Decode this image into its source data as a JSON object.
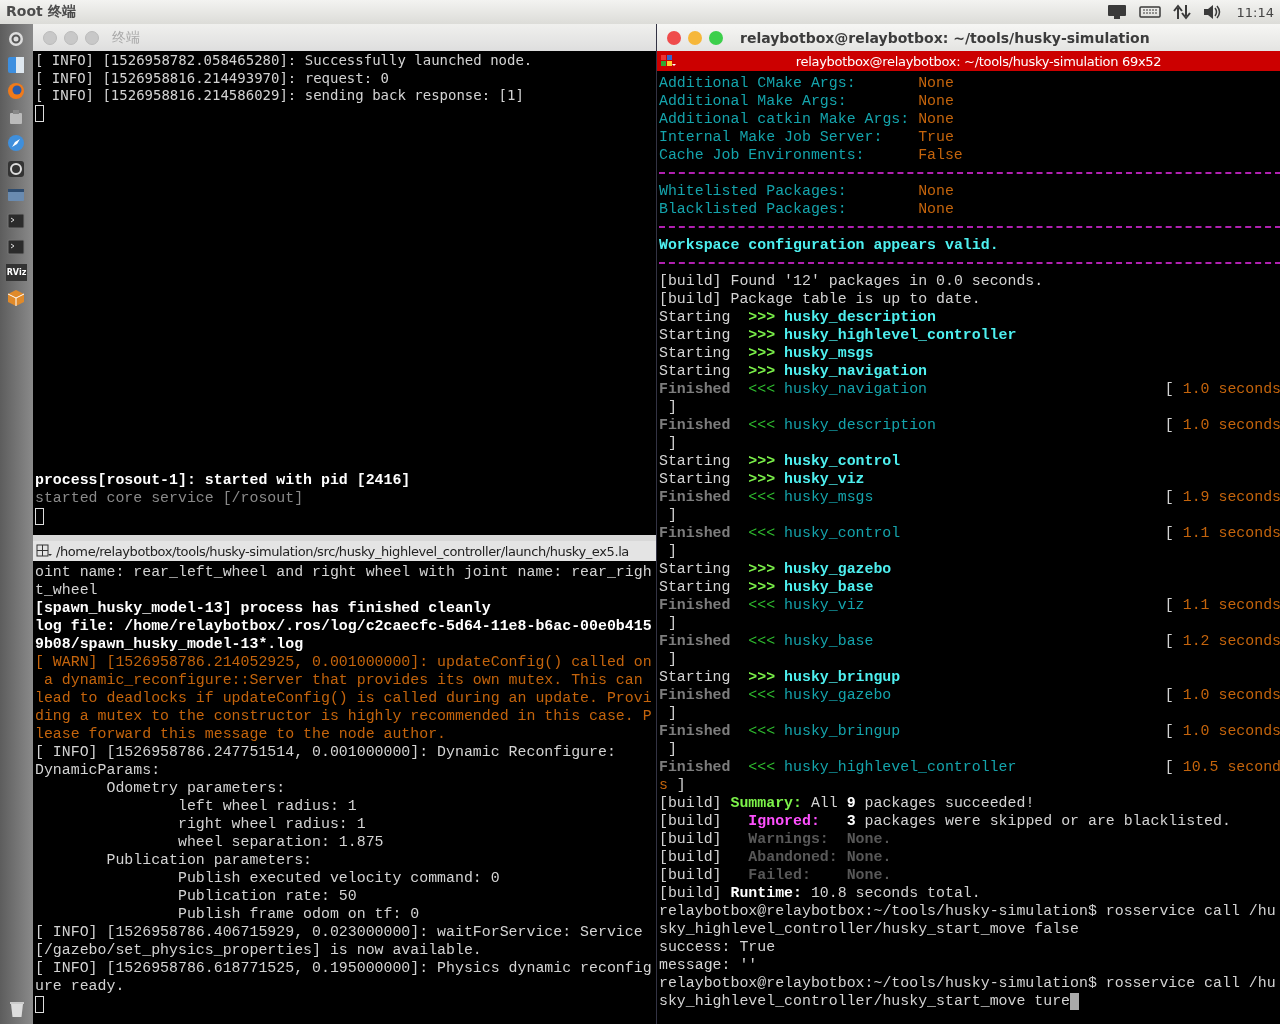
{
  "top_bar": {
    "title": "Root 终端",
    "indicators": [
      {
        "kind": "display"
      },
      {
        "kind": "keyboard"
      },
      {
        "kind": "network"
      },
      {
        "kind": "speaker"
      }
    ],
    "clock": "11:14"
  },
  "launcher": {
    "items": [
      {
        "kind": "ring"
      },
      {
        "kind": "face"
      },
      {
        "kind": "globe"
      },
      {
        "kind": "drive"
      },
      {
        "kind": "compass"
      },
      {
        "kind": "disc"
      },
      {
        "kind": "window"
      },
      {
        "kind": "terminal"
      },
      {
        "kind": "terminal"
      },
      {
        "kind": "label",
        "label": "RViz"
      },
      {
        "kind": "package"
      }
    ],
    "trash": {
      "kind": "trash"
    }
  },
  "left_window": {
    "title": "终端",
    "active": false,
    "lines": [
      {
        "kind": "text",
        "segments": [
          {
            "text": "[ INFO] [1526958782.058465280]: Successfully launched node.",
            "kind": "plain"
          }
        ]
      },
      {
        "kind": "text",
        "segments": [
          {
            "text": "[ INFO] [1526958816.214493970]: request: 0",
            "kind": "plain"
          }
        ]
      },
      {
        "kind": "text",
        "segments": [
          {
            "text": "[ INFO] [1526958816.214586029]: sending back response: [1]",
            "kind": "plain"
          }
        ]
      },
      {
        "kind": "cursor",
        "focused": false
      }
    ]
  },
  "middle_pane": {
    "lines": [
      {
        "kind": "text",
        "segments": [
          {
            "text": "process[rosout-1]: started with pid [2416]",
            "kind": "bold"
          }
        ]
      },
      {
        "kind": "text",
        "segments": [
          {
            "text": "started core service [/rosout]",
            "kind": "dim"
          }
        ]
      },
      {
        "kind": "cursor",
        "focused": false
      }
    ]
  },
  "bottom_pane": {
    "title": "/home/relaybotbox/tools/husky-simulation/src/husky_highlevel_controller/launch/husky_ex5.la",
    "lines": [
      {
        "kind": "text",
        "segments": [
          {
            "text": "oint name: rear_left_wheel and right wheel with joint name: rear_righ",
            "kind": "plain"
          }
        ]
      },
      {
        "kind": "text",
        "segments": [
          {
            "text": "t_wheel",
            "kind": "plain"
          }
        ]
      },
      {
        "kind": "text",
        "segments": [
          {
            "text": "[spawn_husky_model-13] process has finished cleanly",
            "kind": "bold"
          }
        ]
      },
      {
        "kind": "text",
        "segments": [
          {
            "text": "log file: /home/relaybotbox/.ros/log/c2caecfc-5d64-11e8-b6ac-00e0b415",
            "kind": "bold"
          }
        ]
      },
      {
        "kind": "text",
        "segments": [
          {
            "text": "9b08/spawn_husky_model-13*.log",
            "kind": "bold"
          }
        ]
      },
      {
        "kind": "text",
        "segments": [
          {
            "text": "[ WARN] [1526958786.214052925, 0.001000000]: updateConfig() called on",
            "kind": "warn"
          }
        ]
      },
      {
        "kind": "text",
        "segments": [
          {
            "text": " a dynamic_reconfigure::Server that provides its own mutex. This can",
            "kind": "warn"
          }
        ]
      },
      {
        "kind": "text",
        "segments": [
          {
            "text": "lead to deadlocks if updateConfig() is called during an update. Provi",
            "kind": "warn"
          }
        ]
      },
      {
        "kind": "text",
        "segments": [
          {
            "text": "ding a mutex to the constructor is highly recommended in this case. P",
            "kind": "warn"
          }
        ]
      },
      {
        "kind": "text",
        "segments": [
          {
            "text": "lease forward this message to the node author.",
            "kind": "warn"
          }
        ]
      },
      {
        "kind": "text",
        "segments": [
          {
            "text": "[ INFO] [1526958786.247751514, 0.001000000]: Dynamic Reconfigure:",
            "kind": "plain"
          }
        ]
      },
      {
        "kind": "text",
        "segments": [
          {
            "text": "DynamicParams:",
            "kind": "plain"
          }
        ]
      },
      {
        "kind": "text",
        "segments": [
          {
            "text": "        Odometry parameters:",
            "kind": "plain"
          }
        ]
      },
      {
        "kind": "text",
        "segments": [
          {
            "text": "                left wheel radius: 1",
            "kind": "plain"
          }
        ]
      },
      {
        "kind": "text",
        "segments": [
          {
            "text": "                right wheel radius: 1",
            "kind": "plain"
          }
        ]
      },
      {
        "kind": "text",
        "segments": [
          {
            "text": "                wheel separation: 1.875",
            "kind": "plain"
          }
        ]
      },
      {
        "kind": "text",
        "segments": [
          {
            "text": "        Publication parameters:",
            "kind": "plain"
          }
        ]
      },
      {
        "kind": "text",
        "segments": [
          {
            "text": "                Publish executed velocity command: 0",
            "kind": "plain"
          }
        ]
      },
      {
        "kind": "text",
        "segments": [
          {
            "text": "                Publication rate: 50",
            "kind": "plain"
          }
        ]
      },
      {
        "kind": "text",
        "segments": [
          {
            "text": "                Publish frame odom on tf: 0",
            "kind": "plain"
          }
        ]
      },
      {
        "kind": "text",
        "segments": [
          {
            "text": "[ INFO] [1526958786.406715929, 0.023000000]: waitForService: Service",
            "kind": "plain"
          }
        ]
      },
      {
        "kind": "text",
        "segments": [
          {
            "text": "[/gazebo/set_physics_properties] is now available.",
            "kind": "plain"
          }
        ]
      },
      {
        "kind": "text",
        "segments": [
          {
            "text": "[ INFO] [1526958786.618771525, 0.195000000]: Physics dynamic reconfig",
            "kind": "plain"
          }
        ]
      },
      {
        "kind": "text",
        "segments": [
          {
            "text": "ure ready.",
            "kind": "plain"
          }
        ]
      },
      {
        "kind": "cursor",
        "focused": false
      }
    ]
  },
  "right_window": {
    "title": "relaybotbox@relaybotbox: ~/tools/husky-simulation",
    "active": true,
    "pane_title": "relaybotbox@relaybotbox: ~/tools/husky-simulation 69x52",
    "lines": [
      {
        "kind": "setting",
        "key": "Additional CMake Args:",
        "value": "None"
      },
      {
        "kind": "setting",
        "key": "Additional Make Args:",
        "value": "None"
      },
      {
        "kind": "setting",
        "key": "Additional catkin Make Args:",
        "value": "None"
      },
      {
        "kind": "setting",
        "key": "Internal Make Job Server:",
        "value": "True"
      },
      {
        "kind": "setting",
        "key": "Cache Job Environments:",
        "value": "False"
      },
      {
        "kind": "divider"
      },
      {
        "kind": "setting",
        "key": "Whitelisted Packages:",
        "value": "None"
      },
      {
        "kind": "setting",
        "key": "Blacklisted Packages:",
        "value": "None"
      },
      {
        "kind": "divider"
      },
      {
        "kind": "text",
        "segments": [
          {
            "text": "Workspace configuration appears valid.",
            "kind": "cyan-bold"
          }
        ]
      },
      {
        "kind": "divider"
      },
      {
        "kind": "text",
        "segments": [
          {
            "text": "[build] Found '12' packages in 0.0 seconds.",
            "kind": "plain"
          }
        ]
      },
      {
        "kind": "text",
        "segments": [
          {
            "text": "[build] Package table is up to date.",
            "kind": "plain"
          }
        ]
      },
      {
        "kind": "start",
        "status": "Starting",
        "marker": ">>>",
        "package": "husky_description"
      },
      {
        "kind": "start",
        "status": "Starting",
        "marker": ">>>",
        "package": "husky_highlevel_controller"
      },
      {
        "kind": "start",
        "status": "Starting",
        "marker": ">>>",
        "package": "husky_msgs"
      },
      {
        "kind": "start",
        "status": "Starting",
        "marker": ">>>",
        "package": "husky_navigation"
      },
      {
        "kind": "finish",
        "status": "Finished",
        "marker": "<<<",
        "package": "husky_navigation",
        "open": "[",
        "time": "1.0 seconds"
      },
      {
        "kind": "close",
        "text": "]"
      },
      {
        "kind": "finish",
        "status": "Finished",
        "marker": "<<<",
        "package": "husky_description",
        "open": "[",
        "time": "1.0 seconds"
      },
      {
        "kind": "close",
        "text": "]"
      },
      {
        "kind": "start",
        "status": "Starting",
        "marker": ">>>",
        "package": "husky_control"
      },
      {
        "kind": "start",
        "status": "Starting",
        "marker": ">>>",
        "package": "husky_viz"
      },
      {
        "kind": "finish",
        "status": "Finished",
        "marker": "<<<",
        "package": "husky_msgs",
        "open": "[",
        "time": "1.9 seconds"
      },
      {
        "kind": "close",
        "text": "]"
      },
      {
        "kind": "finish",
        "status": "Finished",
        "marker": "<<<",
        "package": "husky_control",
        "open": "[",
        "time": "1.1 seconds"
      },
      {
        "kind": "close",
        "text": "]"
      },
      {
        "kind": "start",
        "status": "Starting",
        "marker": ">>>",
        "package": "husky_gazebo"
      },
      {
        "kind": "start",
        "status": "Starting",
        "marker": ">>>",
        "package": "husky_base"
      },
      {
        "kind": "finish",
        "status": "Finished",
        "marker": "<<<",
        "package": "husky_viz",
        "open": "[",
        "time": "1.1 seconds"
      },
      {
        "kind": "close",
        "text": "]"
      },
      {
        "kind": "finish",
        "status": "Finished",
        "marker": "<<<",
        "package": "husky_base",
        "open": "[",
        "time": "1.2 seconds"
      },
      {
        "kind": "close",
        "text": "]"
      },
      {
        "kind": "start",
        "status": "Starting",
        "marker": ">>>",
        "package": "husky_bringup"
      },
      {
        "kind": "finish",
        "status": "Finished",
        "marker": "<<<",
        "package": "husky_gazebo",
        "open": "[",
        "time": "1.0 seconds"
      },
      {
        "kind": "close",
        "text": "]"
      },
      {
        "kind": "finish",
        "status": "Finished",
        "marker": "<<<",
        "package": "husky_bringup",
        "open": "[",
        "time": "1.0 seconds"
      },
      {
        "kind": "close",
        "text": "]"
      },
      {
        "kind": "finish",
        "status": "Finished",
        "marker": "<<<",
        "package": "husky_highlevel_controller",
        "open": "[",
        "time": "10.5 second"
      },
      {
        "kind": "text",
        "segments": [
          {
            "text": "s",
            "kind": "orange"
          },
          {
            "text": " ]",
            "kind": "plain"
          }
        ]
      },
      {
        "kind": "text",
        "segments": [
          {
            "text": "[build] ",
            "kind": "plain"
          },
          {
            "text": "Summary:",
            "kind": "green-bold"
          },
          {
            "text": " All ",
            "kind": "plain"
          },
          {
            "text": "9",
            "kind": "bold"
          },
          {
            "text": " packages succeeded!",
            "kind": "plain"
          }
        ]
      },
      {
        "kind": "text",
        "segments": [
          {
            "text": "[build]",
            "kind": "plain"
          },
          {
            "text": "   Ignored:",
            "kind": "magenta-bold"
          },
          {
            "text": "   3",
            "kind": "bold"
          },
          {
            "text": " packages were skipped or are blacklisted.",
            "kind": "plain"
          }
        ]
      },
      {
        "kind": "text",
        "segments": [
          {
            "text": "[build]",
            "kind": "plain"
          },
          {
            "text": "   Warnings:  None.",
            "kind": "faint-bold"
          }
        ]
      },
      {
        "kind": "text",
        "segments": [
          {
            "text": "[build]",
            "kind": "plain"
          },
          {
            "text": "   Abandoned: None.",
            "kind": "faint-bold"
          }
        ]
      },
      {
        "kind": "text",
        "segments": [
          {
            "text": "[build]",
            "kind": "plain"
          },
          {
            "text": "   Failed:    None.",
            "kind": "faint-bold"
          }
        ]
      },
      {
        "kind": "text",
        "segments": [
          {
            "text": "[build] ",
            "kind": "plain"
          },
          {
            "text": "Runtime:",
            "kind": "bold"
          },
          {
            "text": " 10.8 seconds total.",
            "kind": "plain"
          }
        ]
      },
      {
        "kind": "text",
        "segments": [
          {
            "text": "relaybotbox@relaybotbox:~/tools/husky-simulation$ rosservice call /hu",
            "kind": "plain"
          }
        ]
      },
      {
        "kind": "text",
        "segments": [
          {
            "text": "sky_highlevel_controller/husky_start_move false",
            "kind": "plain"
          }
        ]
      },
      {
        "kind": "text",
        "segments": [
          {
            "text": "success: True",
            "kind": "plain"
          }
        ]
      },
      {
        "kind": "text",
        "segments": [
          {
            "text": "message: ''",
            "kind": "plain"
          }
        ]
      },
      {
        "kind": "text",
        "segments": [
          {
            "text": "relaybotbox@relaybotbox:~/tools/husky-simulation$ rosservice call /hu",
            "kind": "plain"
          }
        ]
      },
      {
        "kind": "text",
        "cursor": true,
        "segments": [
          {
            "text": "sky_highlevel_controller/husky_start_move ture",
            "kind": "plain"
          }
        ]
      }
    ]
  }
}
